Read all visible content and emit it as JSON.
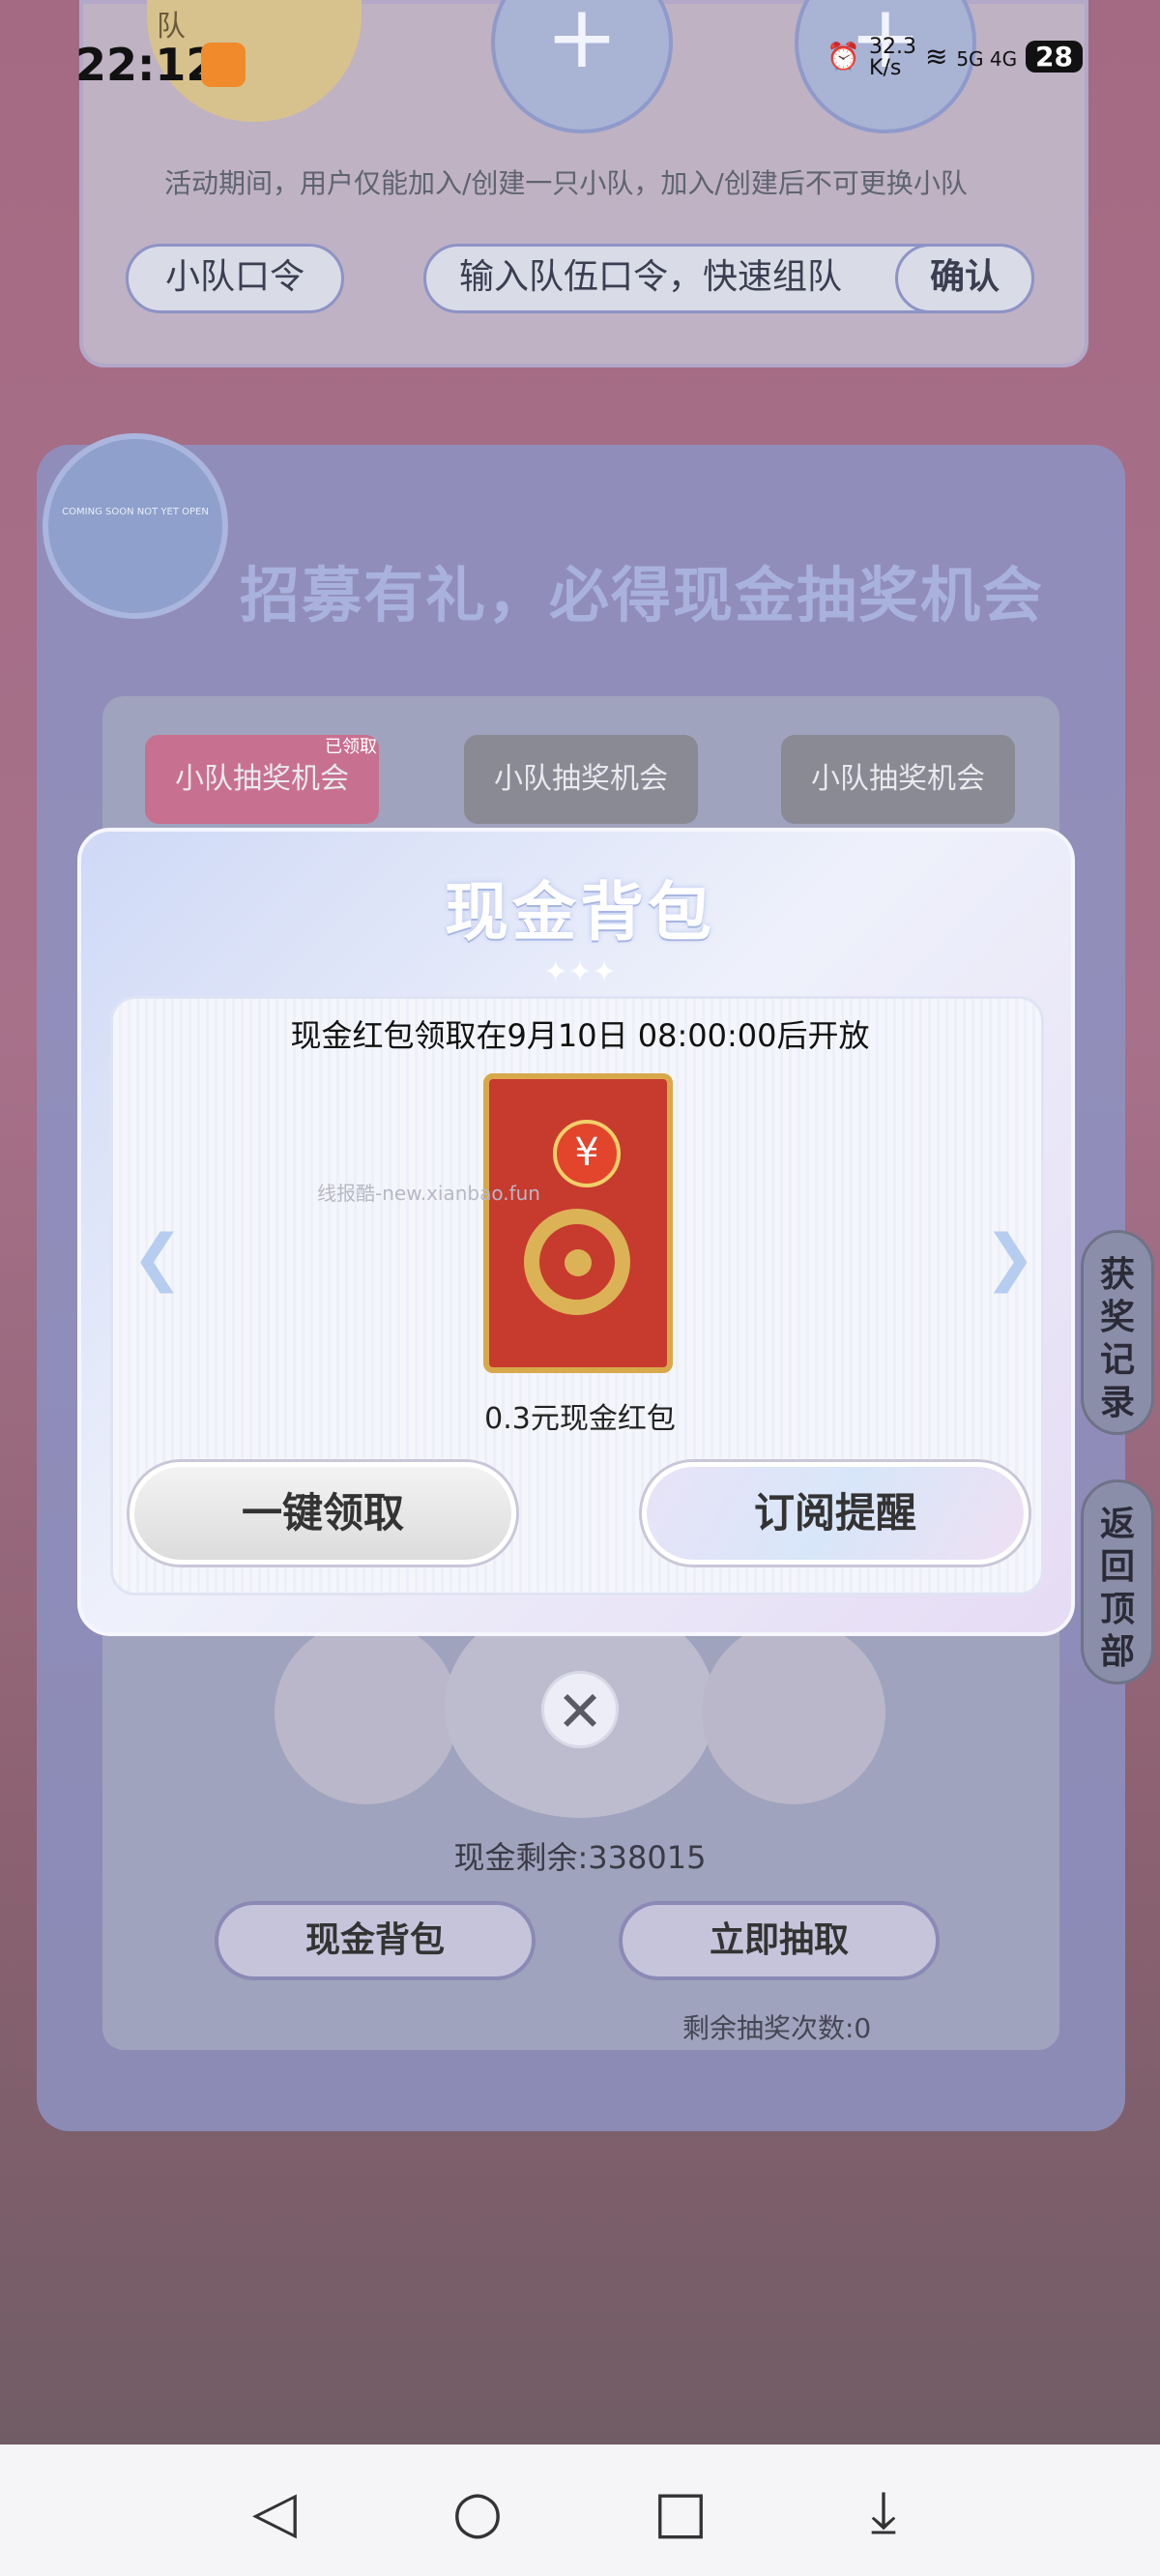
{
  "status": {
    "time": "22:12",
    "net_speed": "32.3\nK/s",
    "signals": "5G  4G",
    "battery": "28"
  },
  "team": {
    "avatar_text": "队",
    "hint": "活动期间，用户仅能加入/创建一只小队，加入/创建后不可更换小队",
    "code_label": "小队口令",
    "code_placeholder": "输入队伍口令，快速组队",
    "confirm": "确认"
  },
  "recruit": {
    "title": "招募有礼，必得现金抽奖机会",
    "badge_text": "COMING SOON NOT YET OPEN",
    "tabs": [
      {
        "label": "小队抽奖机会",
        "tag": "已领取"
      },
      {
        "label": "小队抽奖机会"
      },
      {
        "label": "小队抽奖机会"
      }
    ],
    "cash_remaining": "现金剩余:338015",
    "btn_bag": "现金背包",
    "btn_draw": "立即抽取",
    "draw_count": "剩余抽奖次数:0"
  },
  "side": {
    "records": "获奖记录",
    "top": "返回顶部"
  },
  "modal": {
    "title": "现金背包",
    "sparkles": "✦✦✦",
    "open_note": "现金红包领取在9月10日 08:00:00后开放",
    "watermark": "线报酷-new.xianbao.fun",
    "reward_name": "0.3元现金红包",
    "yen": "¥",
    "btn_claim": "一键领取",
    "btn_subscribe": "订阅提醒",
    "close": "✕"
  },
  "nav": {
    "back": "◁",
    "home": "○",
    "recents": "□",
    "menu": "⤓"
  },
  "icons": [
    "alarm-icon",
    "wifi-icon",
    "signal-icon",
    "battery-icon",
    "plus-icon",
    "close-icon",
    "back-nav-icon",
    "home-nav-icon",
    "recents-nav-icon",
    "menu-nav-icon"
  ],
  "colors": {
    "accent": "#8b89b5",
    "envelope_red": "#c73a2e",
    "gold": "#dcb256"
  }
}
